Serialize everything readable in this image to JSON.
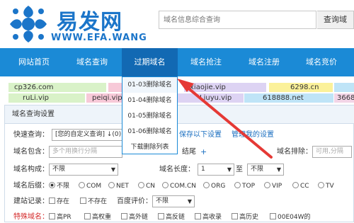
{
  "brand": {
    "name_cn": "易发网",
    "name_en": "WWW.EFA.WANG"
  },
  "search": {
    "placeholder": "域名信息综合查询",
    "button": "查询域"
  },
  "nav": [
    {
      "label": "网站首页"
    },
    {
      "label": "域名查询"
    },
    {
      "label": "过期域名"
    },
    {
      "label": "域名抢注"
    },
    {
      "label": "域名注册"
    },
    {
      "label": "域名竞价"
    }
  ],
  "dropdown": [
    "01-03删除域名",
    "01-04删除域名",
    "01-05删除域名",
    "01-06删除域名",
    "下载删除列表"
  ],
  "ticker": {
    "row1": [
      {
        "text": "cp326.com",
        "color": "#d9f2c8"
      },
      {
        "text": "",
        "color": "#f7c9d8"
      },
      {
        "text": "xiaojie.vip",
        "color": "#ddd3f3"
      },
      {
        "text": "6298.cn",
        "color": "#fbf19a"
      },
      {
        "text": "",
        "color": "#bfe4f7"
      }
    ],
    "row2": [
      {
        "text": "ruLi.vip",
        "color": "#d9f2c8"
      },
      {
        "text": "peiqi.vip",
        "color": "#f7c9d8"
      },
      {
        "text": "Liuyu.vip",
        "color": "#ddd3f3"
      },
      {
        "text": "618888.net",
        "color": "#bfe4f7"
      },
      {
        "text": "3668",
        "color": "#f3d5e7"
      }
    ]
  },
  "panel": {
    "title": "域名查询设置",
    "quick_label": "快速查询：",
    "quick_value": "[您的自定义查询] ↓(0)",
    "save_link": "保存以下设置",
    "manage_link": "管理我的设置",
    "contains_label": "域名包含：",
    "contains_placeholder": "多个用换行分隔",
    "suffix_frag": "结尾",
    "exclude_label": "域名排除：",
    "exclude_placeholder": "可用,分隔",
    "compose_label": "域名构成：",
    "compose_value": "不限",
    "length_label": "域名长度：",
    "length_min": "1",
    "length_to": "至",
    "length_max": "不限",
    "tld_label": "域名后缀：",
    "tlds": [
      "不限",
      "COM",
      "NET",
      "CN",
      "COM.CN",
      "ORG",
      "TOP",
      "VIP",
      "CC",
      "TV"
    ],
    "site_label": "建站记录：",
    "site_opts": [
      "存在",
      "不存在"
    ],
    "baidu_label": "百度评价：",
    "baidu_value": "不限",
    "special_label": "特殊域名：",
    "special_opts": [
      "高PR",
      "高权重",
      "高外链",
      "高反链",
      "高收录",
      "高历史",
      "00E04W的"
    ]
  }
}
